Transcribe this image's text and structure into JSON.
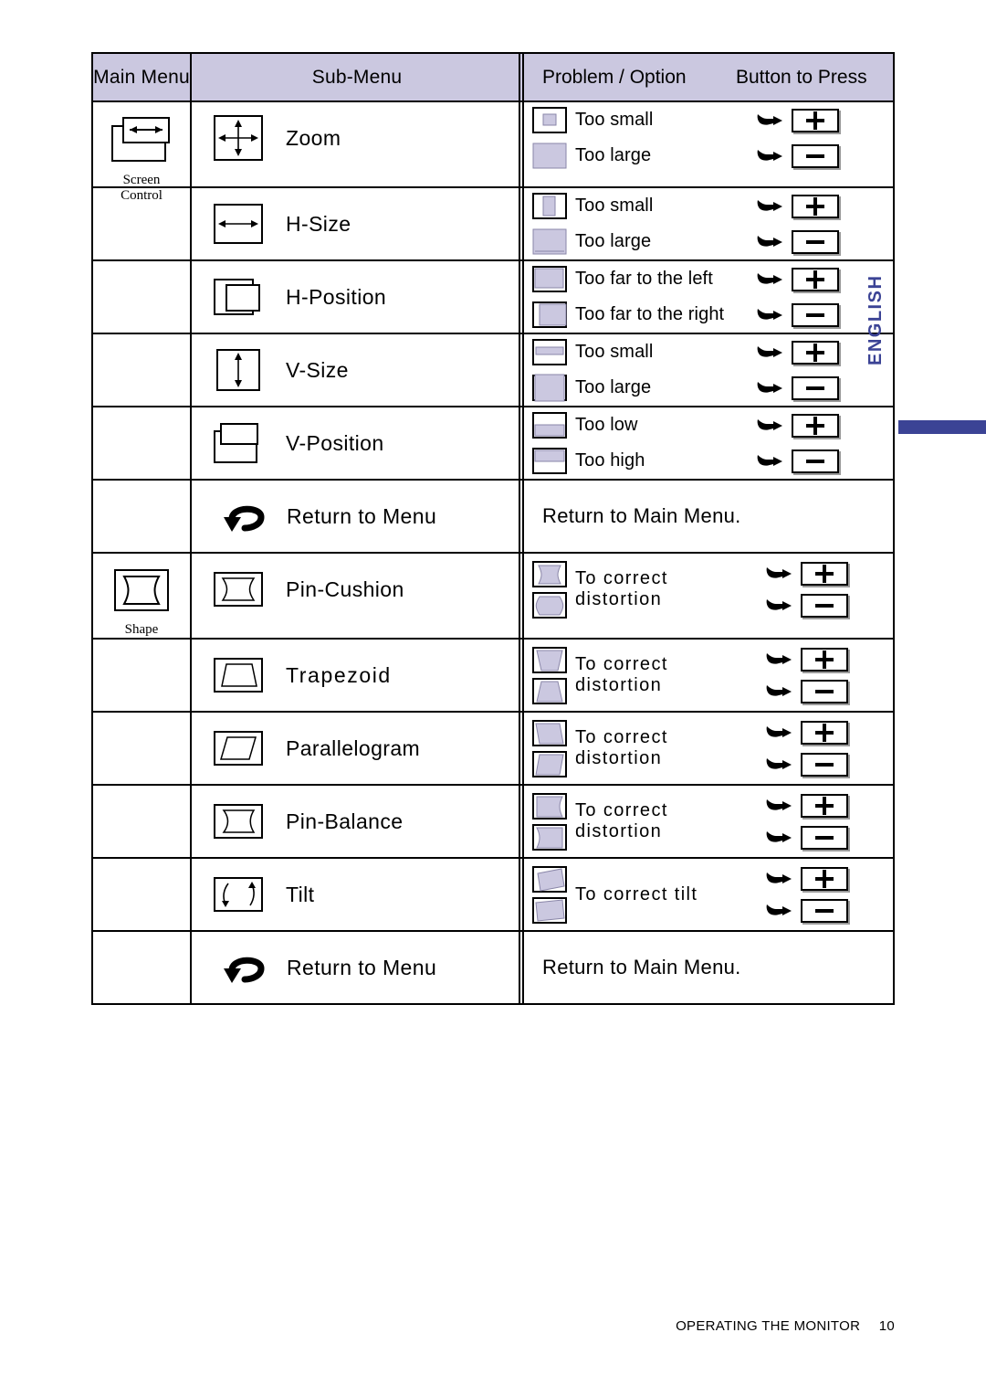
{
  "header": {
    "main_menu": "Main Menu",
    "sub_menu": "Sub-Menu",
    "problem_option": "Problem / Option",
    "button_to_press": "Button to Press",
    "band_color": "#cbc8e0"
  },
  "accent": {
    "lavender": "#cbc8e0",
    "english_blue": "#3b4395",
    "border": "#000000"
  },
  "sections": [
    {
      "main_label": "Screen\nControl",
      "main_label_line1": "Screen",
      "main_label_line2": "Control",
      "main_icon": "screen-control-icon",
      "rows": [
        {
          "sub_label": "Zoom",
          "sub_icon": "zoom-icon",
          "options": [
            {
              "icon": "screen-small-both-icon",
              "text": "Too small",
              "button": "+"
            },
            {
              "icon": "screen-large-both-icon",
              "text": "Too large",
              "button": "−"
            }
          ]
        },
        {
          "sub_label": "H-Size",
          "sub_icon": "h-size-icon",
          "options": [
            {
              "icon": "screen-narrow-icon",
              "text": "Too small",
              "button": "+"
            },
            {
              "icon": "screen-wide-icon",
              "text": "Too large",
              "button": "−"
            }
          ]
        },
        {
          "sub_label": "H-Position",
          "sub_icon": "h-position-icon",
          "options": [
            {
              "icon": "screen-shift-left-icon",
              "text": "Too far to the left",
              "button": "+"
            },
            {
              "icon": "screen-shift-right-icon",
              "text": "Too far to the right",
              "button": "−"
            }
          ]
        },
        {
          "sub_label": "V-Size",
          "sub_icon": "v-size-icon",
          "options": [
            {
              "icon": "screen-short-icon",
              "text": "Too small",
              "button": "+"
            },
            {
              "icon": "screen-tall-icon",
              "text": "Too large",
              "button": "−"
            }
          ]
        },
        {
          "sub_label": "V-Position",
          "sub_icon": "v-position-icon",
          "options": [
            {
              "icon": "screen-low-icon",
              "text": "Too low",
              "button": "+"
            },
            {
              "icon": "screen-high-icon",
              "text": "Too high",
              "button": "−"
            }
          ]
        }
      ],
      "return_row": {
        "sub_label": "Return to Menu",
        "sub_icon": "return-arrow-icon",
        "problem_text": "Return to Main Menu."
      }
    },
    {
      "main_label": "Shape",
      "main_label_line1": "Shape",
      "main_label_line2": "",
      "main_icon": "shape-icon",
      "rows": [
        {
          "sub_label": "Pin-Cushion",
          "sub_icon": "pin-cushion-icon",
          "merged_text": "To correct distortion",
          "options": [
            {
              "icon": "pincushion-in-icon",
              "button": "+"
            },
            {
              "icon": "pincushion-out-icon",
              "button": "−"
            }
          ]
        },
        {
          "sub_label": "Trapezoid",
          "sub_icon": "trapezoid-icon",
          "merged_text": "To correct distortion",
          "options": [
            {
              "icon": "trapezoid-narrow-bottom-icon",
              "button": "+"
            },
            {
              "icon": "trapezoid-narrow-top-icon",
              "button": "−"
            }
          ]
        },
        {
          "sub_label": "Parallelogram",
          "sub_icon": "parallelogram-icon",
          "merged_text": "To correct distortion",
          "options": [
            {
              "icon": "parallelogram-right-icon",
              "button": "+"
            },
            {
              "icon": "parallelogram-left-icon",
              "button": "−"
            }
          ]
        },
        {
          "sub_label": "Pin-Balance",
          "sub_icon": "pin-balance-icon",
          "merged_text": "To correct distortion",
          "options": [
            {
              "icon": "pinbalance-right-icon",
              "button": "+"
            },
            {
              "icon": "pinbalance-left-icon",
              "button": "−"
            }
          ]
        },
        {
          "sub_label": "Tilt",
          "sub_icon": "tilt-icon",
          "merged_text": "To correct tilt",
          "options": [
            {
              "icon": "tilt-ccw-icon",
              "button": "+"
            },
            {
              "icon": "tilt-cw-icon",
              "button": "−"
            }
          ]
        }
      ],
      "return_row": {
        "sub_label": "Return to Menu",
        "sub_icon": "return-arrow-icon",
        "problem_text": "Return to Main Menu."
      }
    }
  ],
  "sidebar": {
    "language_tab": "ENGLISH"
  },
  "footer": {
    "chapter": "OPERATING THE MONITOR",
    "page": "10"
  }
}
